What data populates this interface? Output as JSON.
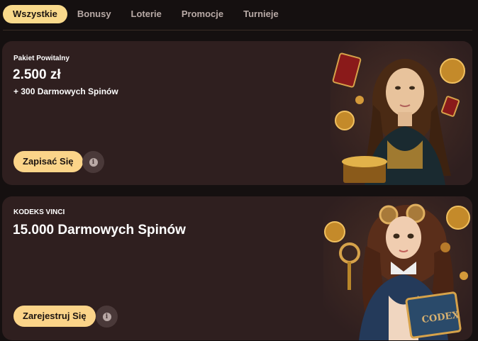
{
  "tabs": [
    {
      "label": "Wszystkie",
      "active": true
    },
    {
      "label": "Bonusy",
      "active": false
    },
    {
      "label": "Loterie",
      "active": false
    },
    {
      "label": "Promocje",
      "active": false
    },
    {
      "label": "Turnieje",
      "active": false
    }
  ],
  "promos": [
    {
      "subtitle": "Pakiet Powitalny",
      "title": "2.500 zł",
      "extra": "+ 300 Darmowych Spinów",
      "button": "Zapisać Się",
      "info_icon": "info-icon",
      "art": "mona-lisa-treasure-illustration"
    },
    {
      "subtitle": "KODEKS VINCI",
      "title": "15.000 Darmowych Spinów",
      "button": "Zarejestruj Się",
      "info_icon": "info-icon",
      "art": "steampunk-codex-girl-illustration"
    }
  ],
  "colors": {
    "background": "#151010",
    "card": "#2f1f1f",
    "accent": "#fbd489",
    "muted_text": "#b8aaa6"
  }
}
